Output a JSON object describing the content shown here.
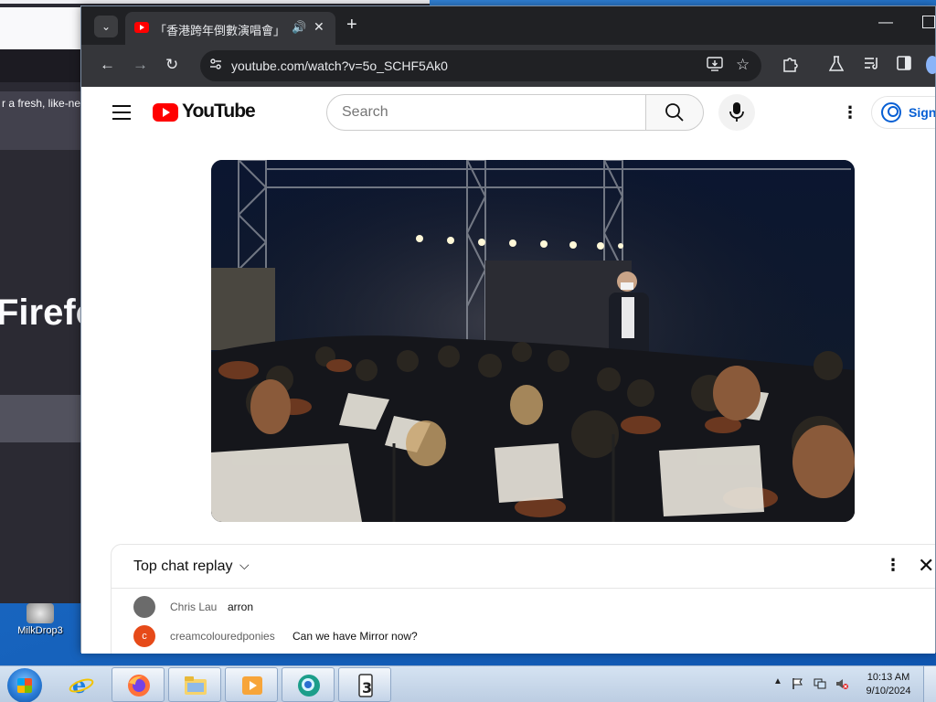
{
  "desktop": {
    "icon_label": "MilkDrop3"
  },
  "firefox_window": {
    "blurb": "r a fresh, like-new",
    "logo_text": "Firefo"
  },
  "chrome": {
    "tab_search_glyph": "⌄",
    "tab_title": "「香港跨年倒數演唱會」線上",
    "tab_audio_glyph": "🔊",
    "tab_close_glyph": "✕",
    "new_tab_glyph": "+",
    "minimize_glyph": "—",
    "url": "youtube.com/watch?v=5o_SCHF5Ak0",
    "nav": {
      "back_glyph": "←",
      "forward_glyph": "→",
      "reload_glyph": "↻"
    }
  },
  "youtube": {
    "logo_text": "YouTube",
    "search_placeholder": "Search",
    "more_glyph": "⋮",
    "signin_label": "Sign"
  },
  "chat": {
    "title": "Top chat replay",
    "chevron": "⌵",
    "more_glyph": "⋮",
    "close_glyph": "✕",
    "messages": [
      {
        "author": "Chris Lau",
        "text": "arron",
        "avatar_letter": "",
        "avatar_color": "#6b6b6b"
      },
      {
        "author": "creamcolouredponies",
        "text": "Can we have Mirror now?",
        "avatar_letter": "c",
        "avatar_color": "#e64a19"
      }
    ]
  },
  "taskbar": {
    "time": "10:13 AM",
    "date": "9/10/2024",
    "apps": [
      "internet-explorer",
      "firefox",
      "file-explorer",
      "media-player",
      "chrome",
      "milkdrop3"
    ]
  }
}
